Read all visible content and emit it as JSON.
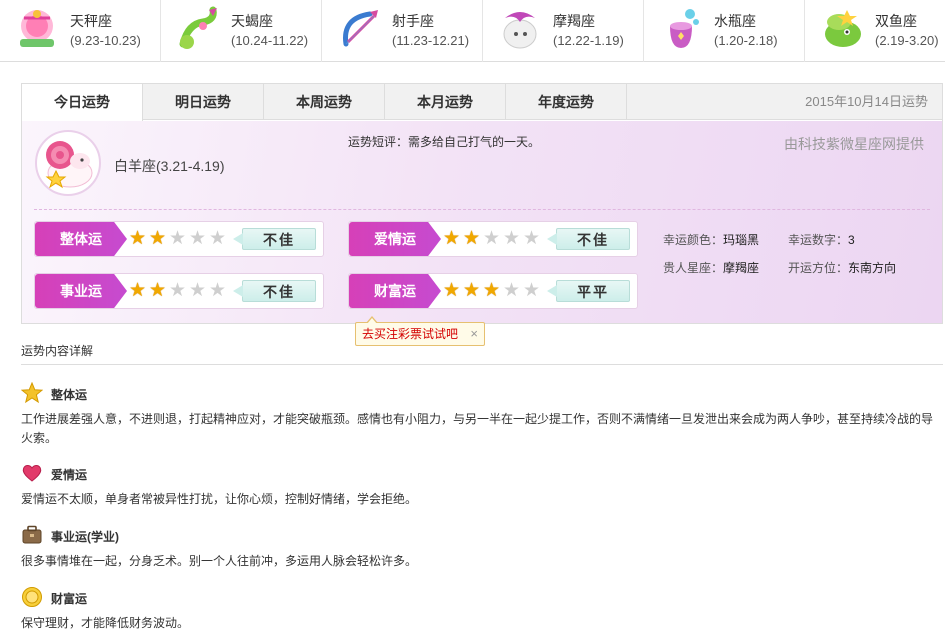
{
  "zodiac_strip": [
    {
      "name": "天秤座",
      "date": "(9.23-10.23)",
      "icon": "libra-icon"
    },
    {
      "name": "天蝎座",
      "date": "(10.24-11.22)",
      "icon": "scorpio-icon"
    },
    {
      "name": "射手座",
      "date": "(11.23-12.21)",
      "icon": "sagittarius-icon"
    },
    {
      "name": "摩羯座",
      "date": "(12.22-1.19)",
      "icon": "capricorn-icon"
    },
    {
      "name": "水瓶座",
      "date": "(1.20-2.18)",
      "icon": "aquarius-icon"
    },
    {
      "name": "双鱼座",
      "date": "(2.19-3.20)",
      "icon": "pisces-icon"
    }
  ],
  "tabs": [
    {
      "label": "今日运势",
      "active": true
    },
    {
      "label": "明日运势",
      "active": false
    },
    {
      "label": "本周运势",
      "active": false
    },
    {
      "label": "本月运势",
      "active": false
    },
    {
      "label": "年度运势",
      "active": false
    }
  ],
  "date_label": "2015年10月14日运势",
  "sign": {
    "name": "白羊座(3.21-4.19)",
    "icon": "aries-icon"
  },
  "comment": "运势短评：需多给自己打气的一天。",
  "provider": "由科技紫微星座网提供",
  "ratings": [
    {
      "label": "整体运",
      "stars": 2,
      "max": 5,
      "verdict": "不佳"
    },
    {
      "label": "爱情运",
      "stars": 2,
      "max": 5,
      "verdict": "不佳"
    },
    {
      "label": "事业运",
      "stars": 2,
      "max": 5,
      "verdict": "不佳"
    },
    {
      "label": "财富运",
      "stars": 3,
      "max": 5,
      "verdict": "平平"
    }
  ],
  "lucky": {
    "color_key": "幸运颜色：",
    "color_val": "玛瑙黑",
    "number_key": "幸运数字：",
    "number_val": "3",
    "noble_key": "贵人星座：",
    "noble_val": "摩羯座",
    "direction_key": "开运方位：",
    "direction_val": "东南方向"
  },
  "tip": {
    "text": "去买注彩票试试吧",
    "close": "×"
  },
  "details_title": "运势内容详解",
  "details": [
    {
      "title": "整体运",
      "icon": "star-icon",
      "text": "工作进展差强人意，不进则退，打起精神应对，才能突破瓶颈。感情也有小阻力，与另一半在一起少提工作，否则不满情绪一旦发泄出来会成为两人争吵，甚至持续冷战的导火索。"
    },
    {
      "title": "爱情运",
      "icon": "heart-icon",
      "text": "爱情运不太顺，单身者常被异性打扰，让你心烦，控制好情绪，学会拒绝。"
    },
    {
      "title": "事业运(学业)",
      "icon": "briefcase-icon",
      "text": "很多事情堆在一起，分身乏术。别一个人往前冲，多运用人脉会轻松许多。"
    },
    {
      "title": "财富运",
      "icon": "coin-icon",
      "text": "保守理财，才能降低财务波动。"
    }
  ],
  "colors": {
    "accent": "#d640b8",
    "star_on": "#f0a800",
    "tip_text": "#d40000"
  }
}
